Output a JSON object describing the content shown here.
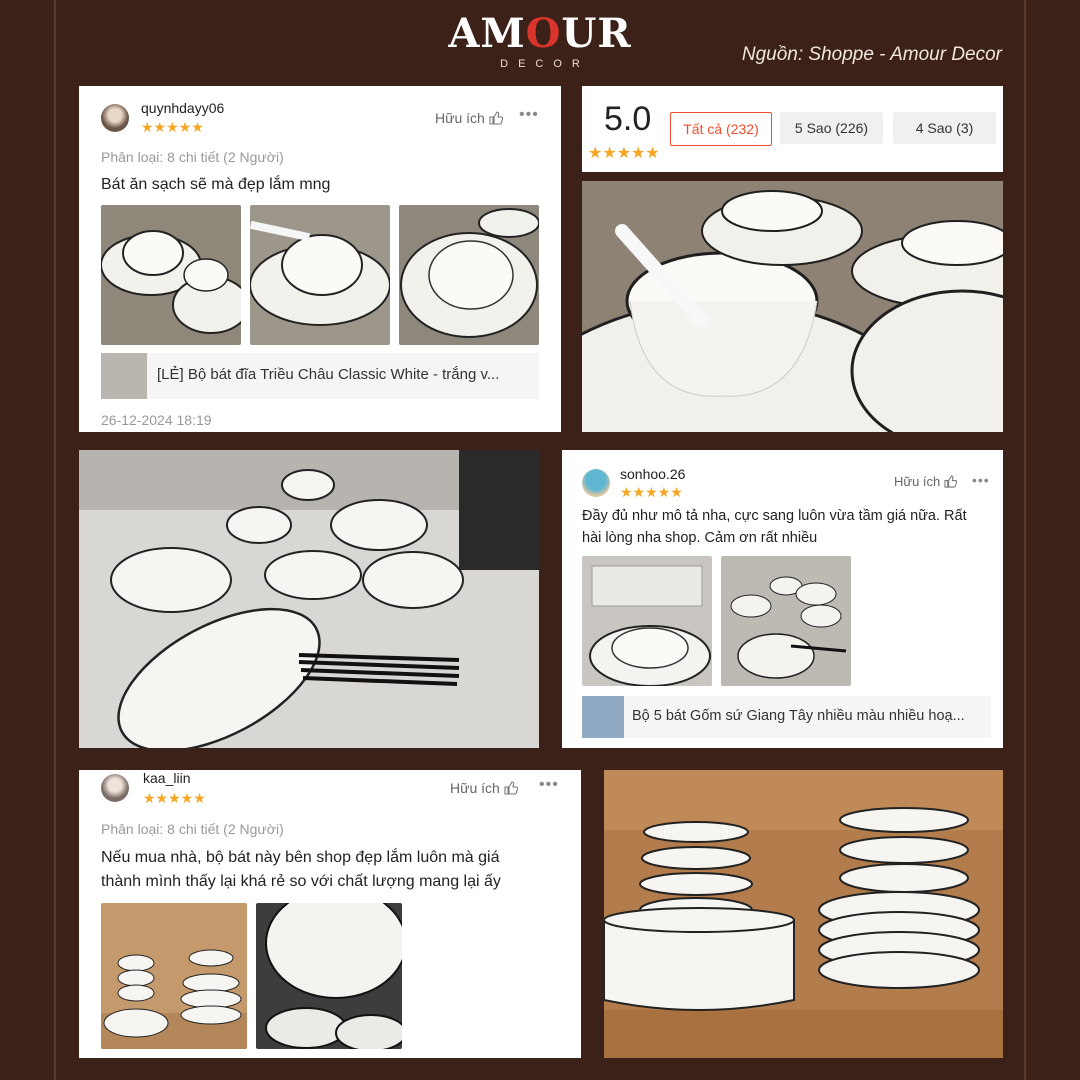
{
  "brand": {
    "logo_text_a": "AM",
    "logo_text_o": "O",
    "logo_text_b": "UR",
    "logo_sub": "DECOR"
  },
  "source": "Nguồn: Shoppe - Amour Decor",
  "review1": {
    "username": "quynhdayy06",
    "stars": "★★★★★",
    "helpful": "Hữu ích",
    "variant": "Phân loại: 8 chi tiết (2 Người)",
    "text": "Bát ăn sạch sẽ mà đẹp lắm mng",
    "product": "[LẺ] Bộ bát đĩa Triều Châu Classic White - trắng v...",
    "date": "26-12-2024 18:19"
  },
  "rating": {
    "score": "5.0",
    "stars": "★★★★★",
    "filters": [
      "Tất cả (232)",
      "5 Sao (226)",
      "4 Sao (3)"
    ]
  },
  "review2": {
    "username": "sonhoo.26",
    "stars": "★★★★★",
    "helpful": "Hữu ích",
    "text_line1": "Đầy đủ như mô tả nha, cực sang luôn vừa tầm giá nữa. Rất",
    "text_line2": "hài lòng nha shop. Cảm ơn rất nhiều",
    "product": "Bộ 5 bát Gốm sứ Giang Tây nhiều màu nhiều hoạ..."
  },
  "review3": {
    "username": "kaa_liin",
    "stars": "★★★★★",
    "helpful": "Hữu ích",
    "variant": "Phân loại: 8 chi tiết (2 Người)",
    "text_line1": "Nếu mua nhà, bộ bát này bên shop đẹp lắm luôn mà giá",
    "text_line2": "thành mình thấy lại khá rẻ so với chất lượng mang lại ấy"
  },
  "icons": {
    "thumbs_up": "thumbs-up-icon",
    "more": "more-dots-icon"
  },
  "colors": {
    "background": "#3b2118",
    "star": "#f5a623",
    "accent": "#ee4d2d"
  }
}
